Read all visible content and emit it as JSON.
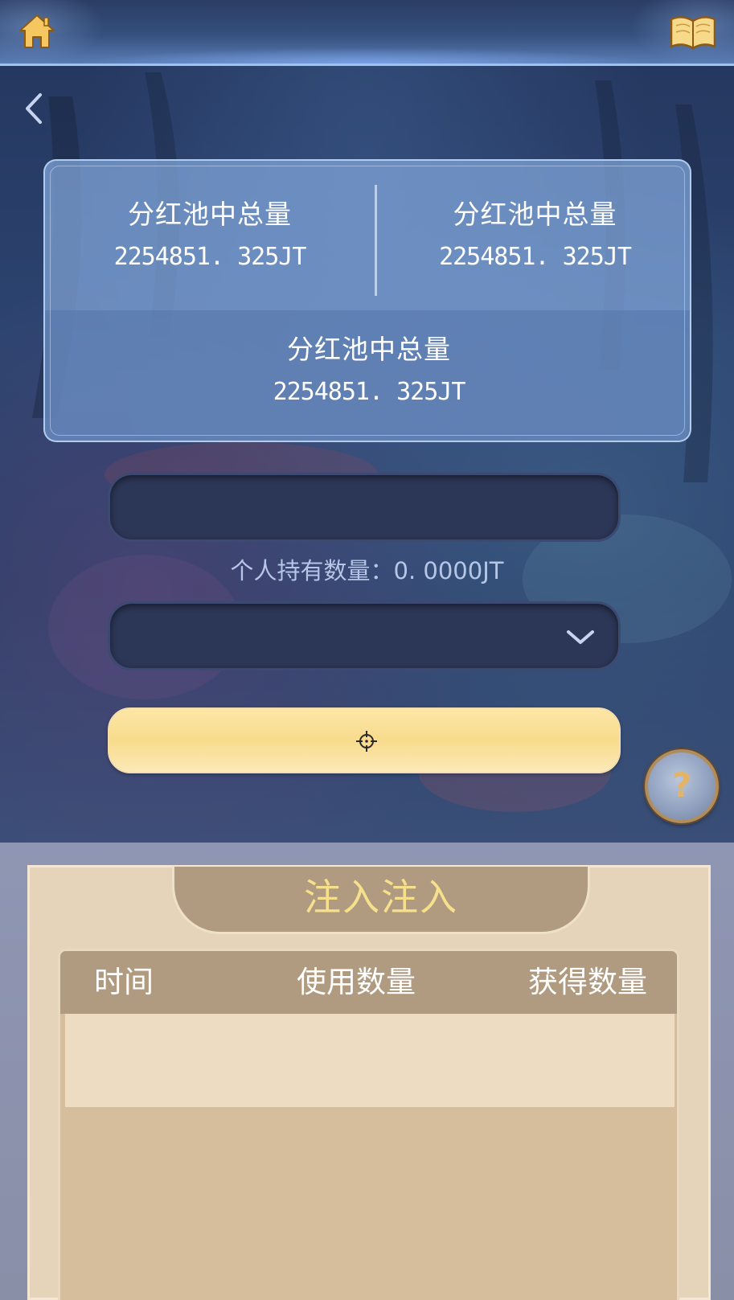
{
  "header": {
    "home_icon": "home-icon",
    "book_icon": "book-icon",
    "back_icon": "chevron-left-icon"
  },
  "stats": [
    {
      "label": "分红池中总量",
      "value": "2254851. 325JT"
    },
    {
      "label": "分红池中总量",
      "value": "2254851. 325JT"
    },
    {
      "label": "分红池中总量",
      "value": "2254851. 325JT"
    }
  ],
  "form": {
    "amount_value": "",
    "amount_placeholder": "",
    "holding_text": "个人持有数量：0. 0000JT",
    "select_value": "",
    "select_icon": "chevron-down-icon",
    "confirm_icon": "crosshair-icon",
    "confirm_label": ""
  },
  "help": {
    "label": "?"
  },
  "records": {
    "title": "注入注入",
    "columns": [
      "时间",
      "使用数量",
      "获得数量"
    ],
    "rows": []
  },
  "colors": {
    "accent_gold": "#f8db8c",
    "title_gold": "#f7e08c",
    "panel_tan": "#b09b81"
  }
}
